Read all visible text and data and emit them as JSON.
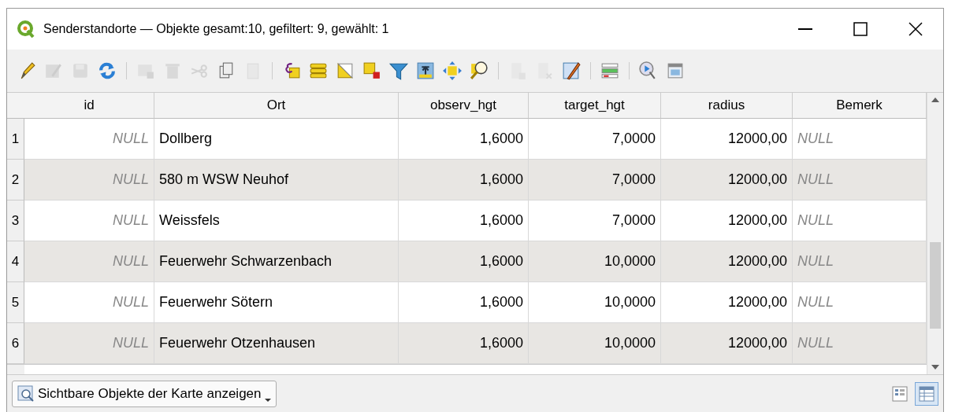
{
  "window": {
    "title": "Senderstandorte — Objekte gesamt:10, gefiltert: 9, gewählt: 1"
  },
  "toolbar": [
    {
      "kind": "pencil",
      "disabled": false
    },
    {
      "kind": "multi-edit",
      "disabled": true
    },
    {
      "kind": "save",
      "disabled": true
    },
    {
      "kind": "refresh",
      "disabled": false
    },
    {
      "kind": "separator"
    },
    {
      "kind": "add-row",
      "disabled": true
    },
    {
      "kind": "delete",
      "disabled": true
    },
    {
      "kind": "cut",
      "disabled": true
    },
    {
      "kind": "copy",
      "disabled": false
    },
    {
      "kind": "paste",
      "disabled": true
    },
    {
      "kind": "separator"
    },
    {
      "kind": "expression",
      "disabled": false
    },
    {
      "kind": "select-all",
      "disabled": false
    },
    {
      "kind": "invert",
      "disabled": false
    },
    {
      "kind": "deselect",
      "disabled": false
    },
    {
      "kind": "filter",
      "disabled": false
    },
    {
      "kind": "move-top",
      "disabled": false
    },
    {
      "kind": "pan",
      "disabled": false
    },
    {
      "kind": "zoom",
      "disabled": false
    },
    {
      "kind": "separator"
    },
    {
      "kind": "new-field",
      "disabled": true
    },
    {
      "kind": "delete-field",
      "disabled": true
    },
    {
      "kind": "field-calc",
      "disabled": false
    },
    {
      "kind": "separator"
    },
    {
      "kind": "conditional",
      "disabled": false
    },
    {
      "kind": "separator"
    },
    {
      "kind": "actions",
      "disabled": false
    },
    {
      "kind": "dock",
      "disabled": false
    }
  ],
  "table": {
    "columns": [
      "id",
      "Ort",
      "observ_hgt",
      "target_hgt",
      "radius",
      "Bemerk"
    ],
    "rows": [
      {
        "number": "1",
        "cells": [
          "NULL",
          "Dollberg",
          "1,6000",
          "7,0000",
          "12000,00",
          "NULL"
        ]
      },
      {
        "number": "2",
        "cells": [
          "NULL",
          "580 m WSW Neuhof",
          "1,6000",
          "7,0000",
          "12000,00",
          "NULL"
        ]
      },
      {
        "number": "3",
        "cells": [
          "NULL",
          "Weissfels",
          "1,6000",
          "7,0000",
          "12000,00",
          "NULL"
        ]
      },
      {
        "number": "4",
        "cells": [
          "NULL",
          "Feuerwehr Schwarzenbach",
          "1,6000",
          "10,0000",
          "12000,00",
          "NULL"
        ]
      },
      {
        "number": "5",
        "cells": [
          "NULL",
          "Feuerwehr Sötern",
          "1,6000",
          "10,0000",
          "12000,00",
          "NULL"
        ]
      },
      {
        "number": "6",
        "cells": [
          "NULL",
          "Feuerwehr Otzenhausen",
          "1,6000",
          "10,0000",
          "12000,00",
          "NULL"
        ]
      }
    ]
  },
  "bottom": {
    "filter_button": "Sichtbare Objekte der Karte anzeigen",
    "views": [
      {
        "kind": "form",
        "selected": false
      },
      {
        "kind": "table",
        "selected": true
      }
    ]
  }
}
